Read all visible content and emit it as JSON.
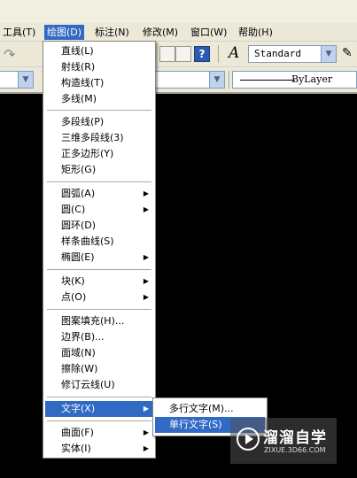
{
  "menubar": {
    "items": [
      {
        "label": "工具(T)"
      },
      {
        "label": "绘图(D)"
      },
      {
        "label": "标注(N)"
      },
      {
        "label": "修改(M)"
      },
      {
        "label": "窗口(W)"
      },
      {
        "label": "帮助(H)"
      }
    ]
  },
  "toolbar": {
    "text_style_value": "Standard",
    "linetype_value": "ByLayer"
  },
  "draw_menu": {
    "items": [
      {
        "label": "直线(L)"
      },
      {
        "label": "射线(R)"
      },
      {
        "label": "构造线(T)"
      },
      {
        "label": "多线(M)"
      },
      {
        "label": "多段线(P)"
      },
      {
        "label": "三维多段线(3)"
      },
      {
        "label": "正多边形(Y)"
      },
      {
        "label": "矩形(G)"
      },
      {
        "label": "圆弧(A)"
      },
      {
        "label": "圆(C)"
      },
      {
        "label": "圆环(D)"
      },
      {
        "label": "样条曲线(S)"
      },
      {
        "label": "椭圆(E)"
      },
      {
        "label": "块(K)"
      },
      {
        "label": "点(O)"
      },
      {
        "label": "图案填充(H)..."
      },
      {
        "label": "边界(B)..."
      },
      {
        "label": "面域(N)"
      },
      {
        "label": "擦除(W)"
      },
      {
        "label": "修订云线(U)"
      },
      {
        "label": "文字(X)"
      },
      {
        "label": "曲面(F)"
      },
      {
        "label": "实体(I)"
      }
    ]
  },
  "text_submenu": {
    "items": [
      {
        "label": "多行文字(M)..."
      },
      {
        "label": "单行文字(S)"
      }
    ]
  },
  "watermark": {
    "title": "溜溜自学",
    "url": "ZIXUE.3D66.COM"
  },
  "colors": {
    "highlight": "#316ac5",
    "canvas": "#000000",
    "chrome": "#ece9d8"
  }
}
